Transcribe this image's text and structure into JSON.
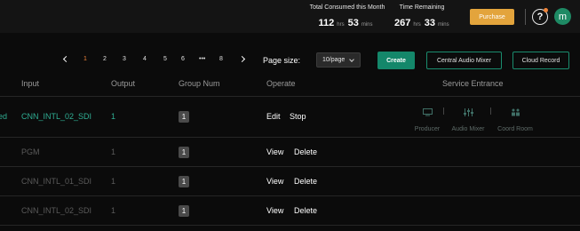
{
  "header": {
    "consumed_label": "Total Consumed this Month",
    "consumed_hours": "112",
    "consumed_mins": "53",
    "remaining_label": "Time Remaining",
    "remaining_hours": "267",
    "remaining_mins": "33",
    "hrs_unit": "hrs",
    "mins_unit": "mins",
    "purchase_label": "Purchase",
    "help_glyph": "?",
    "avatar_letter": "m",
    "accent_color": "#e3a43c"
  },
  "pagination": {
    "pages": [
      "1",
      "2",
      "3",
      "4",
      "5",
      "6",
      "•••",
      "8"
    ],
    "active_page": "1",
    "page_size_label": "Page size:",
    "page_size_value": "10/page"
  },
  "toolbar": {
    "create_label": "Create",
    "mixer_label": "Central Audio Mixer",
    "cloud_label": "Cloud Record"
  },
  "table": {
    "columns": [
      "Input",
      "Output",
      "Group Num",
      "Operate",
      "Service Entrance"
    ],
    "rows": [
      {
        "status": "ed",
        "input": "CNN_INTL_02_SDI",
        "output": "1",
        "group": "1",
        "action1": "Edit",
        "action2": "Stop"
      },
      {
        "status": "",
        "input": "PGM",
        "output": "1",
        "group": "1",
        "action1": "View",
        "action2": "Delete"
      },
      {
        "status": "",
        "input": "CNN_INTL_01_SDI",
        "output": "1",
        "group": "1",
        "action1": "View",
        "action2": "Delete"
      },
      {
        "status": "",
        "input": "CNN_INTL_02_SDI",
        "output": "1",
        "group": "1",
        "action1": "View",
        "action2": "Delete"
      }
    ],
    "services": [
      {
        "label": "Producer",
        "icon": "producer-icon"
      },
      {
        "label": "Audio Mixer",
        "icon": "audio-mixer-icon"
      },
      {
        "label": "Coord Room",
        "icon": "coord-room-icon"
      }
    ]
  }
}
